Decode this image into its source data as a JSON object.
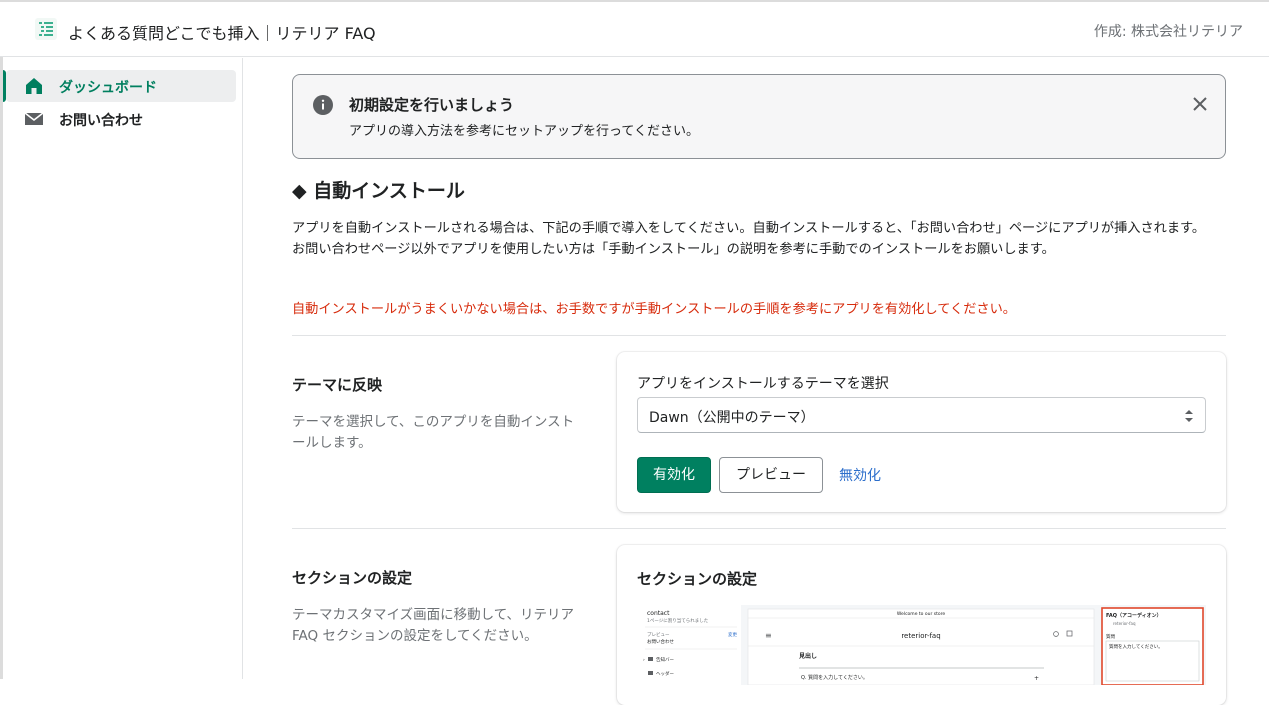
{
  "topbar": {
    "app_title": "よくある質問どこでも挿入｜リテリア FAQ",
    "author": "作成: 株式会社リテリア"
  },
  "sidebar": {
    "items": [
      {
        "label": "ダッシュボード",
        "icon": "home-icon",
        "active": true
      },
      {
        "label": "お問い合わせ",
        "icon": "mail-icon",
        "active": false
      }
    ]
  },
  "banner": {
    "title": "初期設定を行いましょう",
    "text": "アプリの導入方法を参考にセットアップを行ってください。"
  },
  "auto_install": {
    "heading": "◆ 自動インストール",
    "desc_line1": "アプリを自動インストールされる場合は、下記の手順で導入をしてください。自動インストールすると、「お問い合わせ」ページにアプリが挿入されます。",
    "desc_line2": "お問い合わせページ以外でアプリを使用したい方は「手動インストール」の説明を参考に手動でのインストールをお願いします。",
    "warning": "自動インストールがうまくいかない場合は、お手数ですが手動インストールの手順を参考にアプリを有効化してください。"
  },
  "theme_section": {
    "title": "テーマに反映",
    "desc": "テーマを選択して、このアプリを自動インストールします。",
    "select_label": "アプリをインストールするテーマを選択",
    "select_value": "Dawn（公開中のテーマ）",
    "enable_button": "有効化",
    "preview_button": "プレビュー",
    "disable_link": "無効化"
  },
  "section_settings": {
    "title": "セクションの設定",
    "desc": "テーマカスタマイズ画面に移動して、リテリア FAQ セクションの設定をしてください。",
    "card_title": "セクションの設定",
    "preview": {
      "sidebar_title": "contact",
      "sidebar_sub": "1ページに割り当てられました",
      "sidebar_preview": "プレビュー",
      "sidebar_preview_link": "変更",
      "sidebar_page": "お問い合わせ",
      "sidebar_items": [
        "告知バー",
        "ヘッダー"
      ],
      "store_banner": "Welcome to our store",
      "store_name": "reterior-faq",
      "store_heading": "見出し",
      "store_question": "Q. 質問を入力してください。",
      "panel_title": "FAQ（アコーディオン）",
      "panel_sub": "reterior-faq",
      "panel_label": "質問",
      "panel_input": "質問を入力してください。"
    }
  },
  "colors": {
    "primary": "#008060",
    "link": "#2c6ecb",
    "warning": "#d72c0d",
    "highlight": "#e0482b"
  }
}
